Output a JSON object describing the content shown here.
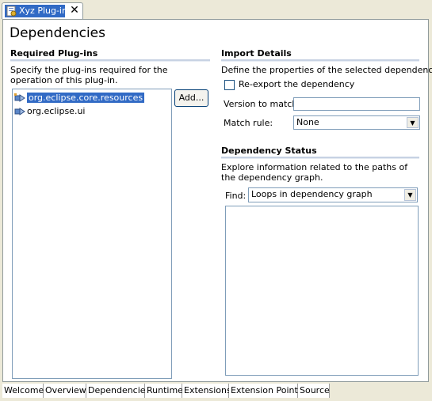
{
  "editor": {
    "tab_title": "Xyz Plug-in",
    "page_title": "Dependencies"
  },
  "required_plugins": {
    "title": "Required Plug-ins",
    "description": "Specify the plug-ins required for the operation of this plug-in.",
    "items": [
      {
        "label": "org.eclipse.core.resources",
        "selected": true
      },
      {
        "label": "org.eclipse.ui",
        "selected": false
      }
    ],
    "add_button": "Add..."
  },
  "import_details": {
    "title": "Import Details",
    "description": "Define the properties of the selected dependency.",
    "reexport_label": "Re-export the dependency",
    "reexport_checked": false,
    "version_label": "Version to match:",
    "version_value": "",
    "match_rule_label": "Match rule:",
    "match_rule_value": "None"
  },
  "dependency_status": {
    "title": "Dependency Status",
    "description": "Explore information related to the paths of the dependency graph.",
    "find_label": "Find:",
    "find_value": "Loops in dependency graph"
  },
  "bottom_tabs": [
    "Welcome",
    "Overview",
    "Dependencies",
    "Runtime",
    "Extensions",
    "Extension Points",
    "Source"
  ],
  "active_bottom_tab": "Dependencies",
  "colors": {
    "accent": "#316ac5",
    "section_title": "#000000",
    "border": "#7f9db9"
  }
}
